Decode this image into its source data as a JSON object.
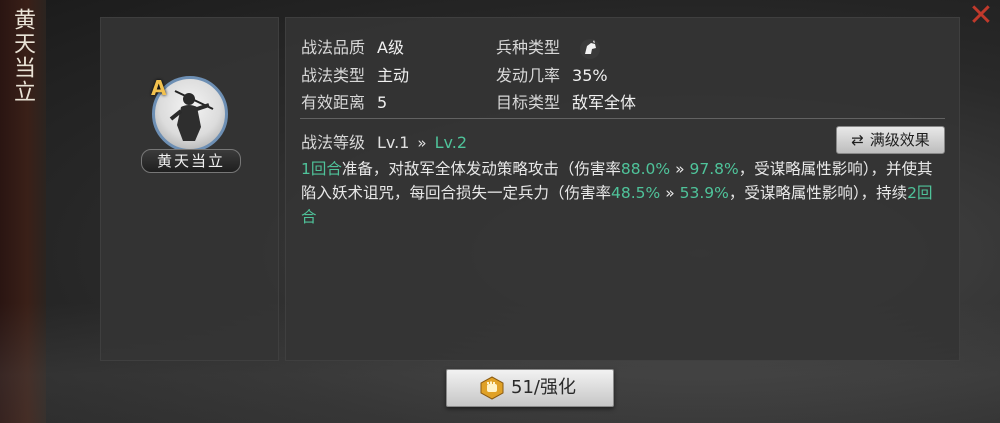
{
  "side_title": "黄天当立",
  "skill": {
    "grade": "A",
    "name": "黄天当立"
  },
  "attributes": {
    "quality_label": "战法品质",
    "quality_value": "A级",
    "troop_label": "兵种类型",
    "troop_icon": "horse-head-icon",
    "type_label": "战法类型",
    "type_value": "主动",
    "rate_label": "发动几率",
    "rate_value": "35%",
    "range_label": "有效距离",
    "range_value": "5",
    "target_label": "目标类型",
    "target_value": "敌军全体"
  },
  "level": {
    "label": "战法等级",
    "current": "Lv.1",
    "arrow": "»",
    "next": "Lv.2",
    "max_button": "满级效果"
  },
  "description": {
    "p1": "1回合",
    "p2": "准备，对敌军全体发动策略攻击（伤害率",
    "p3": "88.0%",
    "p4": " » ",
    "p5": "97.8%",
    "p6": "，受谋略属性影响），并使其陷入妖术诅咒，每回合损失一定兵力（伤害率",
    "p7": "48.5%",
    "p8": " » ",
    "p9": "53.9%",
    "p10": "，受谋略属性影响），持续",
    "p11": "2回合"
  },
  "upgrade_button": {
    "label": "51/强化"
  },
  "colors": {
    "highlight": "#4fc39a",
    "close": "#c0392b",
    "grade": "#f2c14e"
  }
}
